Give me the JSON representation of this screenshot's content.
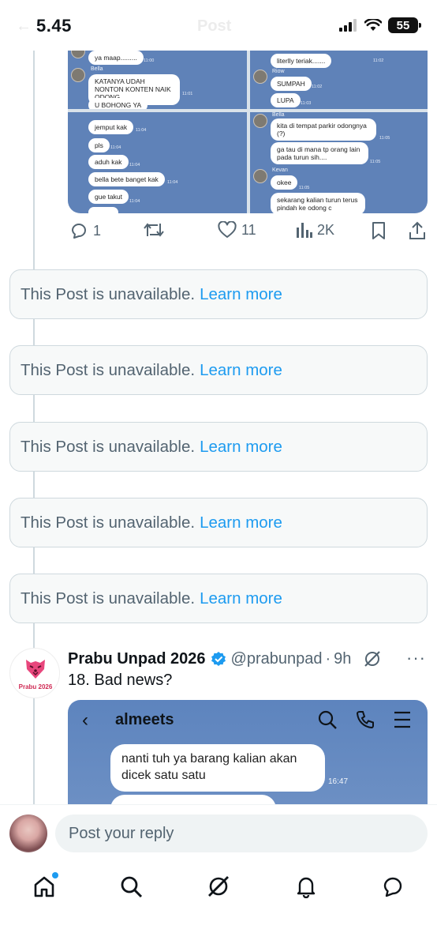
{
  "status_bar": {
    "time": "5.45",
    "battery": "55"
  },
  "header": {
    "back_label": "←",
    "title": "Post"
  },
  "media_grid": {
    "panel1": {
      "msg1": "ya maap.........",
      "ts1": "11:00",
      "sender": "Bella",
      "msg2": "KATANYA UDAH NONTON KONTEN NAIK ODONG",
      "ts2": "11:01",
      "msg3": "U BOHONG YA"
    },
    "panel2": {
      "msg1": "literlly teriak.......",
      "ts1": "11:02",
      "sender": "Riow",
      "msg2": "SUMPAH",
      "ts2": "11:02",
      "msg3": "LUPA",
      "ts3": "11:03"
    },
    "panel3": {
      "msg1": "jemput kak",
      "ts1": "11:04",
      "msg2": "pls",
      "ts2": "11:04",
      "msg3": "aduh kak",
      "ts3": "11:04",
      "msg4": "bella bete banget kak",
      "ts4": "11:04",
      "msg5": "gue takut",
      "ts5": "11:04"
    },
    "panel4": {
      "sender1": "Bella",
      "msg1": "kita di tempat parkir odongnya (?)",
      "ts1": "11:05",
      "msg2": "ga tau di mana tp orang lain pada turun sih....",
      "ts2": "11:05",
      "sender2": "Kevan",
      "msg3": "okee",
      "ts3": "11:05",
      "msg4": "sekarang kalian turun terus pindah ke odong c"
    }
  },
  "actions": {
    "replies": "1",
    "likes": "11",
    "views": "2K"
  },
  "unavailable": [
    {
      "text": "This Post is unavailable.",
      "link": "Learn more"
    },
    {
      "text": "This Post is unavailable.",
      "link": "Learn more"
    },
    {
      "text": "This Post is unavailable.",
      "link": "Learn more"
    },
    {
      "text": "This Post is unavailable.",
      "link": "Learn more"
    },
    {
      "text": "This Post is unavailable.",
      "link": "Learn more"
    }
  ],
  "tweet": {
    "avatar_text": "Prabu 2026",
    "name": "Prabu Unpad 2026",
    "handle": "@prabunpad",
    "separator": "·",
    "time": "9h",
    "more": "···",
    "text": "18. Bad news?",
    "media": {
      "chat_title": "almeets",
      "message": "nanti tuh ya barang kalian akan dicek satu satu",
      "timestamp": "16:47"
    }
  },
  "reply": {
    "placeholder": "Post your reply"
  },
  "colors": {
    "accent": "#1d9bf0",
    "chat_blue": "#5f82b8",
    "muted": "#536471"
  },
  "tabs": [
    "home-icon",
    "search-icon",
    "grok-icon",
    "notifications-icon",
    "messages-icon"
  ]
}
